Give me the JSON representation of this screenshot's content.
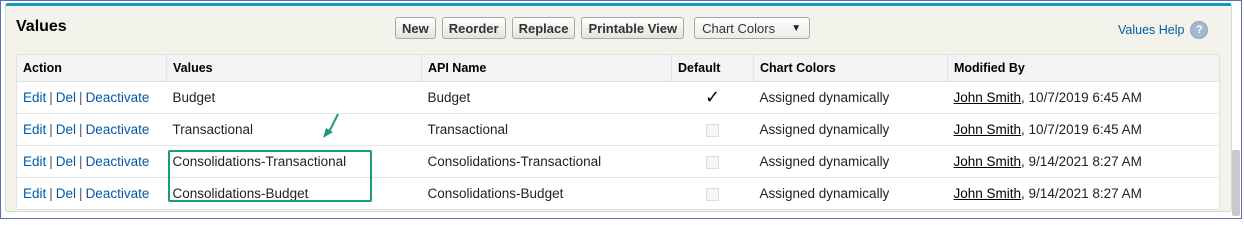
{
  "section": {
    "title": "Values"
  },
  "toolbar": {
    "buttons": [
      "New",
      "Reorder",
      "Replace",
      "Printable View"
    ],
    "chart_colors_select": "Chart Colors"
  },
  "help": {
    "link": "Values Help",
    "icon": "?"
  },
  "table": {
    "headers": [
      "Action",
      "Values",
      "API Name",
      "Default",
      "Chart Colors",
      "Modified By"
    ],
    "action_labels": {
      "edit": "Edit",
      "del": "Del",
      "deactivate": "Deactivate",
      "separator": "|"
    },
    "rows": [
      {
        "value": "Budget",
        "api_name": "Budget",
        "default": true,
        "chart_colors": "Assigned dynamically",
        "modified_by": "John Smith",
        "modified_at": ", 10/7/2019 6:45 AM"
      },
      {
        "value": "Transactional",
        "api_name": "Transactional",
        "default": false,
        "chart_colors": "Assigned dynamically",
        "modified_by": "John Smith",
        "modified_at": ", 10/7/2019 6:45 AM"
      },
      {
        "value": "Consolidations-Transactional",
        "api_name": "Consolidations-Transactional",
        "default": false,
        "chart_colors": "Assigned dynamically",
        "modified_by": "John Smith",
        "modified_at": ", 9/14/2021 8:27 AM"
      },
      {
        "value": "Consolidations-Budget",
        "api_name": "Consolidations-Budget",
        "default": false,
        "chart_colors": "Assigned dynamically",
        "modified_by": "John Smith",
        "modified_at": ", 9/14/2021 8:27 AM"
      }
    ],
    "default_check_glyph": "✓"
  },
  "colors": {
    "accent": "#1797c0",
    "link": "#015ba7",
    "annotation": "#1a9a7e"
  },
  "icons": {
    "dropdown": "triangle-down-icon",
    "help": "question-circle-icon",
    "arrow": "annotation-arrow-icon"
  }
}
